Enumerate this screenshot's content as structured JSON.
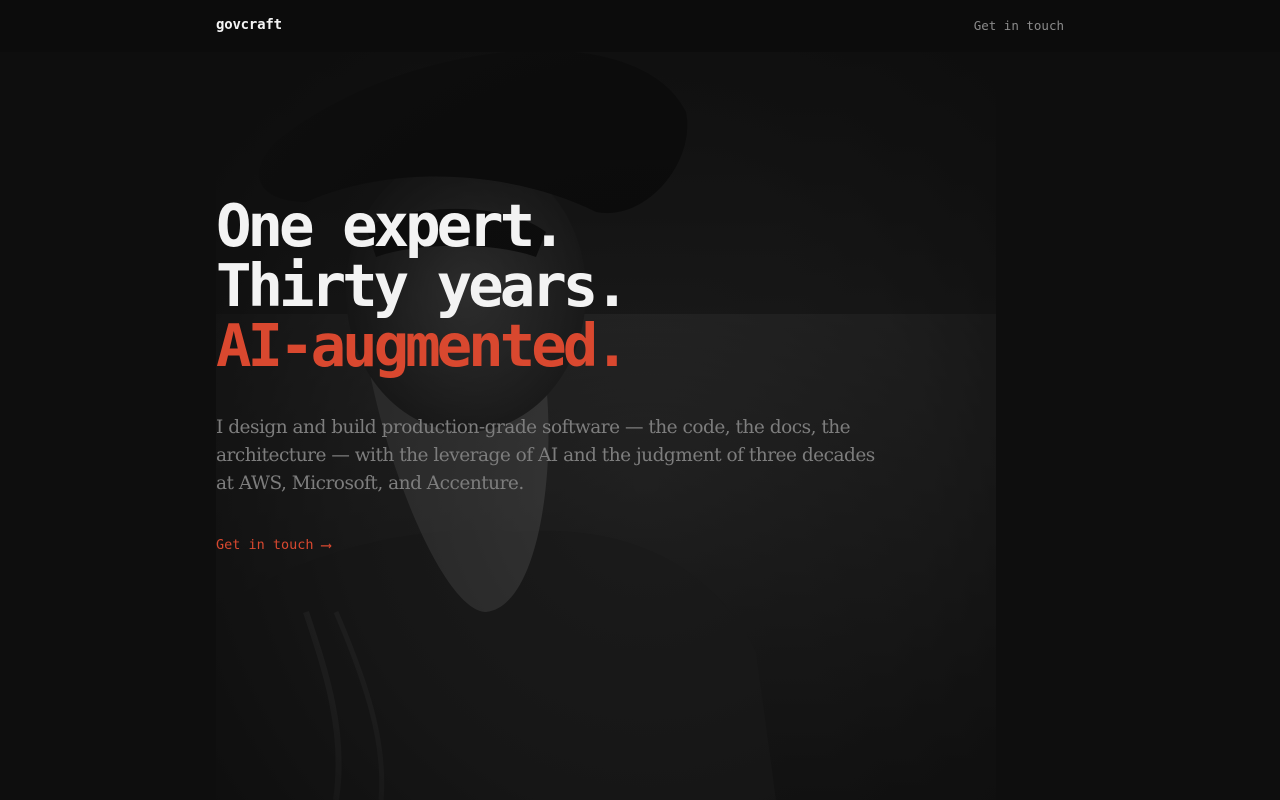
{
  "header": {
    "brand": "govcraft",
    "cta_label": "Get in touch"
  },
  "hero": {
    "headline_line1": "One expert.",
    "headline_line2": "Thirty years.",
    "headline_line3": "AI-augmented.",
    "description": "I design and build production-grade software — the code, the docs, the architecture — with the leverage of AI and the judgment of three decades at AWS, Microsoft, and Accenture.",
    "cta_label": "Get in touch",
    "cta_icon": "arrow-right-icon"
  },
  "colors": {
    "background": "#0e0e0e",
    "accent": "#d9482f",
    "text": "#f3f3f3",
    "muted": "#7d7d7d"
  }
}
